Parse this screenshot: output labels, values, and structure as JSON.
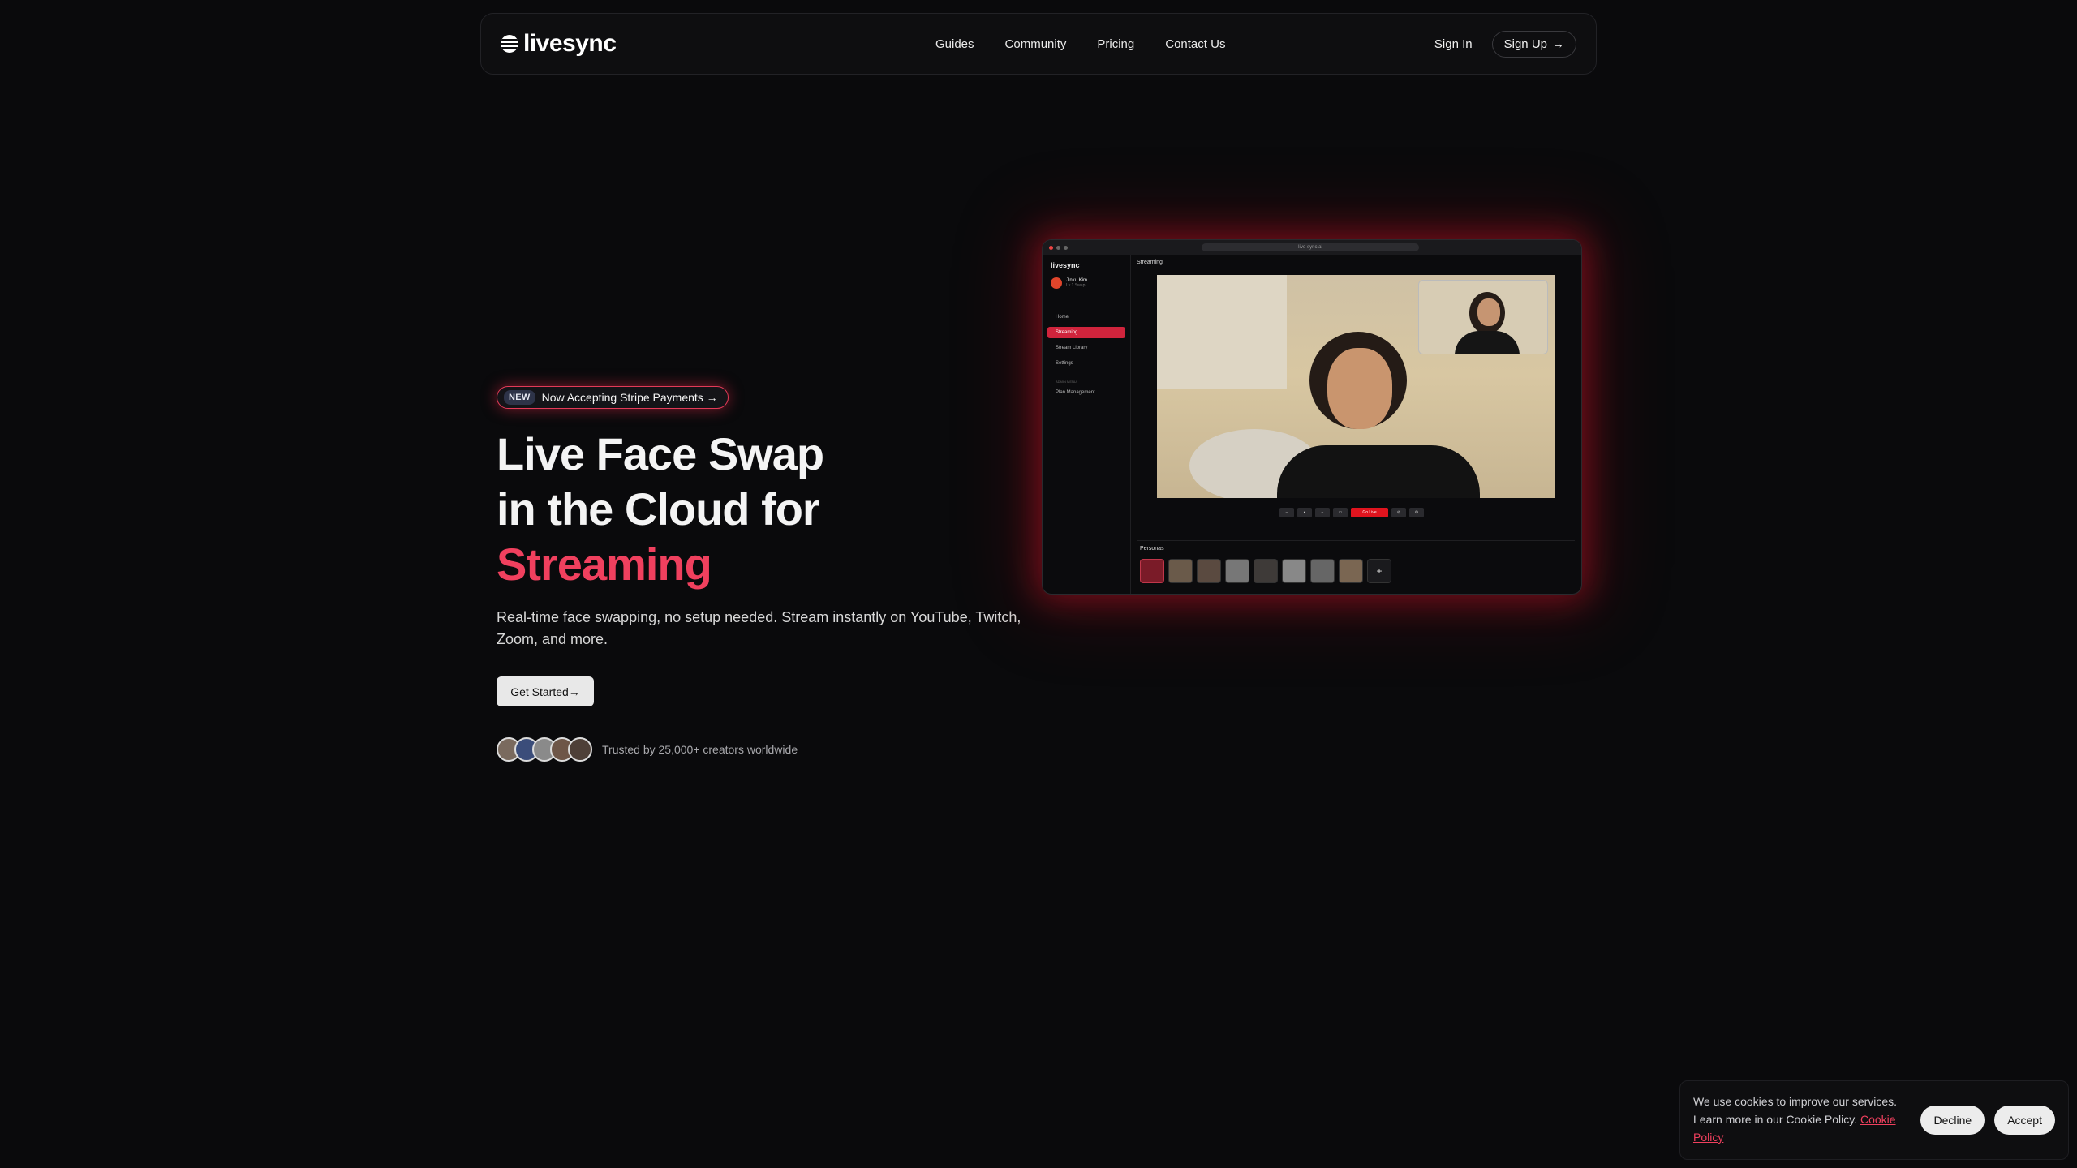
{
  "nav": {
    "brand": "livesync",
    "links": [
      "Guides",
      "Community",
      "Pricing",
      "Contact Us"
    ],
    "sign_in": "Sign In",
    "sign_up": "Sign Up",
    "arrow": "→"
  },
  "hero": {
    "badge_tag": "NEW",
    "badge_text": "Now Accepting Stripe Payments →",
    "title_line1": "Live Face Swap",
    "title_line2": "in the Cloud for",
    "title_accent": "Streaming",
    "subtitle": "Real-time face swapping, no setup needed. Stream instantly on YouTube, Twitch, Zoom, and more.",
    "cta": "Get Started→",
    "trust_text": "Trusted by 25,000+ creators worldwide",
    "accent_color": "#f0405e"
  },
  "mockup": {
    "url": "live-sync.ai",
    "brand": "livesync",
    "user_name": "Jinku Kim",
    "user_sub": "Lv 1 Swap",
    "menu": [
      "Home",
      "Streaming",
      "Stream Library",
      "Settings"
    ],
    "admin_label": "ADMIN MENU",
    "admin_item": "Plan Management",
    "page_title": "Streaming",
    "live_button": "Go Live",
    "personas_label": "Personas",
    "add": "+"
  },
  "cookie": {
    "text": "We use cookies to improve our services. Learn more in our Cookie Policy.",
    "link": "Cookie Policy",
    "decline": "Decline",
    "accept": "Accept"
  }
}
